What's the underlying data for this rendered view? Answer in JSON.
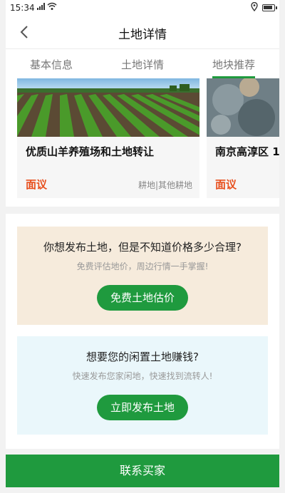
{
  "status": {
    "time": "15:34",
    "signal": "4G",
    "icons": [
      "signal-icon",
      "wifi-icon",
      "location-icon",
      "battery-icon"
    ]
  },
  "nav": {
    "title": "土地详情",
    "back_icon": "chevron-left-icon"
  },
  "tabs": [
    {
      "label": "基本信息",
      "active": false
    },
    {
      "label": "土地详情",
      "active": false
    },
    {
      "label": "地块推荐",
      "active": true
    }
  ],
  "recommend": [
    {
      "title": "优质山羊养殖场和土地转让",
      "price": "面议",
      "tags": "耕地|其他耕地"
    },
    {
      "title": "南京高淳区 1",
      "price": "面议",
      "tags": ""
    }
  ],
  "promo_price": {
    "title": "你想发布土地，但是不知道价格多少合理?",
    "subtitle": "免费评估地价，周边行情一手掌握!",
    "button": "免费土地估价"
  },
  "promo_publish": {
    "title": "想要您的闲置土地赚钱?",
    "subtitle": "快速发布您家闲地，快速找到流转人!",
    "button": "立即发布土地"
  },
  "footer": {
    "contact_label": "联系买家"
  },
  "colors": {
    "accent": "#1f9a3e",
    "price": "#e8501e",
    "promo_warm_bg": "#f6ebdc",
    "promo_cool_bg": "#eaf7fb"
  }
}
